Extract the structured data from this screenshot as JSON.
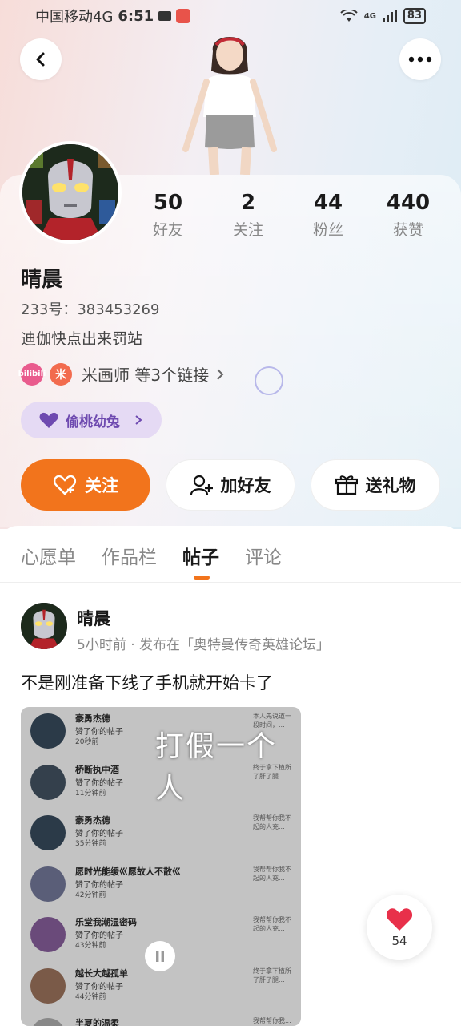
{
  "status_bar": {
    "carrier": "中国移动4G",
    "time": "6:51",
    "network": "4G",
    "battery": "83"
  },
  "icons": {
    "back": "back-arrow-icon",
    "more": "more-dots-icon",
    "follow": "heart-plus-icon",
    "add_friend": "person-add-icon",
    "gift": "gift-icon",
    "medal": "purple-heart-icon",
    "like": "red-heart-icon",
    "pause": "pause-icon"
  },
  "colors": {
    "accent": "#f2741c",
    "medal_bg": "#e5daf4",
    "medal_text": "#6e4ab0",
    "like": "#e8304a"
  },
  "profile": {
    "name": "晴晨",
    "uid_label": "233号：",
    "uid": "383453269",
    "bio": "迪伽快点出来罚站",
    "links_text": "米画师 等3个链接",
    "medal": "偷桃幼兔",
    "stats": [
      {
        "value": "50",
        "label": "好友"
      },
      {
        "value": "2",
        "label": "关注"
      },
      {
        "value": "44",
        "label": "粉丝"
      },
      {
        "value": "440",
        "label": "获赞"
      }
    ],
    "link_badges": [
      "bilibili",
      "米"
    ]
  },
  "actions": {
    "follow": "关注",
    "add_friend": "加好友",
    "gift": "送礼物"
  },
  "tabs": [
    {
      "label": "心愿单",
      "active": false
    },
    {
      "label": "作品栏",
      "active": false
    },
    {
      "label": "帖子",
      "active": true
    },
    {
      "label": "评论",
      "active": false
    }
  ],
  "post": {
    "author": "晴晨",
    "meta": "5小时前 · 发布在「奥特曼传奇英雄论坛」",
    "text": "不是刚准备下线了手机就开始卡了",
    "video_caption": "打假一个人",
    "video_rows": [
      {
        "name": "豪勇杰德",
        "action": "赞了你的帖子",
        "time": "20秒前",
        "snippet": "本人先说道一段时间，..."
      },
      {
        "name": "桥断执中酒",
        "action": "赞了你的帖子",
        "time": "11分钟前",
        "snippet": "終于拿下植所了肝了腿..."
      },
      {
        "name": "豪勇杰德",
        "action": "赞了你的帖子",
        "time": "35分钟前",
        "snippet": "我帮帮你我不起的人充..."
      },
      {
        "name": "愿时光能缓巛愿故人不散巛",
        "action": "赞了你的帖子",
        "time": "42分钟前",
        "snippet": "我帮帮你我不起的人充..."
      },
      {
        "name": "乐堂我潮湿密码",
        "action": "赞了你的帖子",
        "time": "43分钟前",
        "snippet": "我帮帮你我不起的人充..."
      },
      {
        "name": "越长大越孤单",
        "action": "赞了你的帖子",
        "time": "44分钟前",
        "snippet": "終于拿下植所了肝了腿..."
      },
      {
        "name": "半夏的温柔",
        "action": "",
        "time": "",
        "snippet": "我帮帮你我..."
      }
    ],
    "likes": "54"
  }
}
